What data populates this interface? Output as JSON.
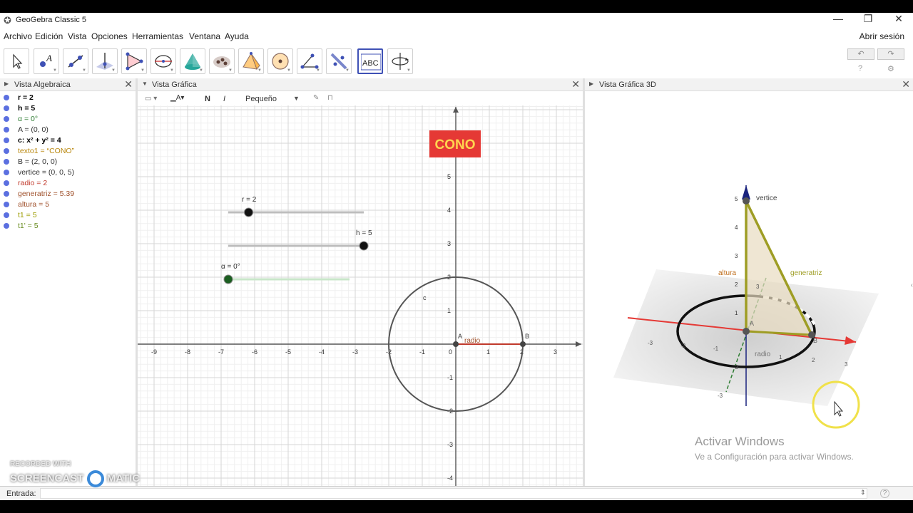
{
  "window": {
    "title": "GeoGebra Classic 5",
    "min": "—",
    "max": "❐",
    "close": "✕"
  },
  "menu": {
    "items": [
      "Archivo",
      "Edición",
      "Vista",
      "Opciones",
      "Herramientas",
      "Ventana",
      "Ayuda"
    ],
    "signin": "Abrir sesión"
  },
  "toolbar": {
    "tools": [
      "move-tool",
      "point-tool",
      "line-tool",
      "perpendicular-tool",
      "polygon-tool",
      "circle-tool",
      "intersect-surfaces-tool",
      "sphere-tool",
      "pyramid-tool",
      "sphere-center-tool",
      "angle-tool",
      "reflect-tool",
      "text-tool",
      "rotate-view-tool"
    ],
    "active_index": 12,
    "text_tool_label": "ABC",
    "undo": "↶",
    "redo": "↷",
    "help": "?",
    "settings": "⚙"
  },
  "algebra": {
    "title": "Vista Algebraica",
    "items": [
      {
        "text": "r = 2",
        "color": "#000000",
        "bold": true
      },
      {
        "text": "h = 5",
        "color": "#000000",
        "bold": true
      },
      {
        "text": "α = 0°",
        "color": "#2e7d32",
        "bold": false
      },
      {
        "text": "A = (0, 0)",
        "color": "#333333",
        "bold": false
      },
      {
        "text": "c: x² + y² = 4",
        "color": "#000000",
        "bold": true
      },
      {
        "text": "texto1 = “CONO”",
        "color": "#b8860b",
        "bold": false
      },
      {
        "text": "B = (2, 0, 0)",
        "color": "#333333",
        "bold": false
      },
      {
        "text": "vertice = (0, 0, 5)",
        "color": "#333333",
        "bold": false
      },
      {
        "text": "radio = 2",
        "color": "#c0392b",
        "bold": false
      },
      {
        "text": "generatriz = 5.39",
        "color": "#a0522d",
        "bold": false
      },
      {
        "text": "altura = 5",
        "color": "#a0522d",
        "bold": false
      },
      {
        "text": "t1 = 5",
        "color": "#9c9c00",
        "bold": false
      },
      {
        "text": "t1' = 5",
        "color": "#6b8e23",
        "bold": false
      }
    ]
  },
  "graphics": {
    "title": "Vista Gráfica",
    "style": {
      "bold": "N",
      "italic": "I",
      "size": "Pequeño"
    },
    "cono_text": "CONO",
    "x_ticks": [
      "-9",
      "-8",
      "-7",
      "-6",
      "-5",
      "-4",
      "-3",
      "-2",
      "-1",
      "0",
      "1",
      "2",
      "3"
    ],
    "y_ticks": [
      "5",
      "4",
      "3",
      "2",
      "1",
      "-1",
      "-2",
      "-3",
      "-4"
    ],
    "sliders": [
      {
        "label": "r = 2",
        "fraction": 0.15
      },
      {
        "label": "h = 5",
        "fraction": 1.0
      },
      {
        "label": "α = 0°",
        "fraction": 0.0
      }
    ],
    "labels": {
      "circle": "c",
      "pointA": "A",
      "pointB": "B",
      "radius": "radio"
    }
  },
  "view3d": {
    "title": "Vista Gráfica 3D",
    "labels": {
      "vertex": "vertice",
      "height": "altura",
      "generatrix": "generatriz",
      "radius": "radio",
      "pointA": "A",
      "pointB": "B"
    },
    "z_ticks": [
      "5",
      "4",
      "3",
      "2",
      "1"
    ],
    "x_ticks": [
      "-3",
      "-2",
      "-1",
      "1",
      "2",
      "3"
    ],
    "y_ticks": [
      "-2",
      "-3",
      "3"
    ]
  },
  "input": {
    "label": "Entrada:",
    "help": "?"
  },
  "overlay": {
    "activate_title": "Activar Windows",
    "activate_sub": "Ve a Configuración para activar Windows.",
    "watermark_top": "RECORDED WITH",
    "watermark_brand": "SCREENCAST",
    "watermark_brand2": "MATIC"
  },
  "colors": {
    "accent": "#3f51b5",
    "cono_bg": "#e53935",
    "cono_text": "#ffd54f",
    "dot": "#5b6fe0"
  }
}
